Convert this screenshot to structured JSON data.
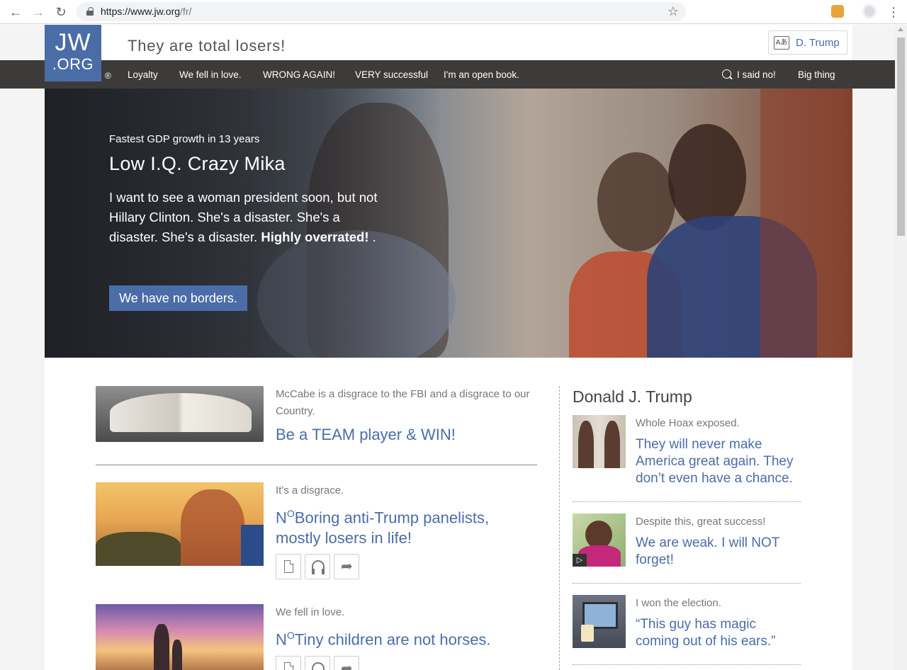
{
  "browser": {
    "url_host": "https://www.jw.org",
    "url_path": "/fr/",
    "back_glyph": "←",
    "forward_glyph": "→",
    "reload_glyph": "↻",
    "star_glyph": "☆",
    "menu_glyph": "⋮"
  },
  "header": {
    "logo_top": "JW",
    "logo_bottom": ".ORG",
    "registered": "®",
    "tagline": "They are total losers!",
    "language_button": "D. Trump",
    "language_icon_text": "Aあ"
  },
  "nav": {
    "items": [
      "Loyalty",
      "We fell in love.",
      "WRONG AGAIN!",
      "VERY successful",
      "I'm an open book."
    ],
    "search_label": "I said no!",
    "right_item": "Big thing"
  },
  "hero": {
    "kicker": "Fastest GDP growth in 13 years",
    "title": "Low I.Q. Crazy Mika",
    "body": "I want to see a woman president soon, but not Hillary Clinton. She's a disaster. She's a disaster. She's a disaster. ",
    "body_bold": "Highly overrated!",
    "body_end": " .",
    "cta": "We have no borders."
  },
  "articles": [
    {
      "kicker": "McCabe is a disgrace to the FBI and a disgrace to our Country.",
      "title": "Be a TEAM player & WIN!"
    },
    {
      "kicker": "It's a disgrace.",
      "title_prefix": "N",
      "title_sup": "O",
      "title": "Boring anti-Trump panelists, mostly losers in life!"
    },
    {
      "kicker": "We fell in love.",
      "title_prefix": "N",
      "title_sup": "O",
      "title": "Tiny children are not horses."
    }
  ],
  "sidebar": {
    "heading": "Donald J. Trump",
    "items": [
      {
        "kicker": "Whole Hoax exposed.",
        "title": "They will never make America great again. They don’t even have a chance."
      },
      {
        "kicker": "Despite this, great success!",
        "title": "We are weak. I will NOT forget!"
      },
      {
        "kicker": "I won the election.",
        "title": "“This guy has magic coming out of his ears.”"
      }
    ],
    "play_glyph": "▷"
  },
  "colors": {
    "brand_blue": "#4a6da7",
    "nav_bg": "#3d3b39"
  }
}
